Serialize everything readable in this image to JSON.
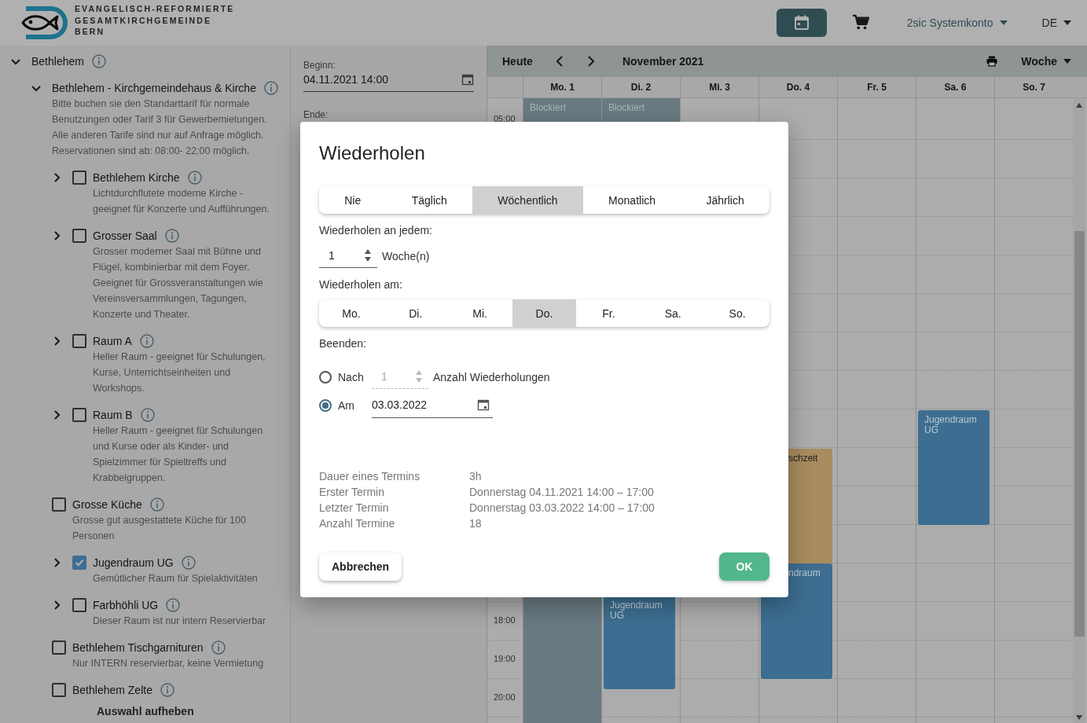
{
  "header": {
    "logo_lines": [
      "EVANGELISCH-REFORMIERTE",
      "GESAMTKIRCHGEMEINDE",
      "BERN"
    ],
    "account": "2sic Systemkonto",
    "language": "DE"
  },
  "sidebar": {
    "items": [
      {
        "label": "Bethlehem",
        "expanded": true,
        "children": [
          {
            "label": "Bethlehem - Kirchgemeindehaus & Kirche",
            "expanded": true,
            "description": "Bitte buchen sie den Standarttarif für normale Benutzungen oder Tarif 3 für Gewerbemietungen. Alle anderen Tarife sind nur auf Anfrage möglich. Reservationen sind ab: 08:00- 22:00 möglich.",
            "children": [
              {
                "label": "Bethlehem Kirche",
                "expanded": false,
                "checked": false,
                "description": "Lichtdurchflutete moderne Kirche - geeignet für Konzerte und Aufführungen."
              },
              {
                "label": "Grosser Saal",
                "expanded": false,
                "checked": false,
                "description": "Grosser moderner Saal mit Bühne und Flügel, kombinierbar mit dem Foyer. Geeignet für Grossveranstaltungen wie Vereinsversammlungen, Tagungen, Konzerte und Theater."
              },
              {
                "label": "Raum A",
                "expanded": false,
                "checked": false,
                "description": "Heller Raum - geeignet für Schulungen, Kurse, Unterrichtseinheiten und Workshops."
              },
              {
                "label": "Raum B",
                "expanded": false,
                "checked": false,
                "description": "Heller Raum - geeignet für Schulungen und Kurse oder als Kinder- und Spielzimmer für Spieltreffs und Krabbelgruppen."
              },
              {
                "label": "Grosse Küche",
                "checked": false,
                "description": "Grosse gut ausgestattete Küche für 100 Personen"
              },
              {
                "label": "Jugendraum UG",
                "expanded": false,
                "checked": true,
                "description": "Gemütlicher Raum für Spielaktivitäten"
              },
              {
                "label": "Farbhöhli UG",
                "expanded": false,
                "checked": false,
                "description": "Dieser Raum ist nur intern Reservierbar"
              },
              {
                "label": "Bethlehem Tischgarnituren",
                "checked": false,
                "description": "Nur INTERN reservierbar, keine Vermietung"
              },
              {
                "label": "Bethlehem Zelte",
                "checked": false
              }
            ]
          }
        ]
      }
    ],
    "clear_button": "Auswahl aufheben"
  },
  "booking_form": {
    "fields": [
      {
        "label": "Beginn:",
        "value": "04.11.2021 14:00"
      },
      {
        "label": "Ende:"
      }
    ]
  },
  "calendar": {
    "today_button": "Heute",
    "period": "November 2021",
    "view": "Woche",
    "days": [
      "Mo. 1",
      "Di. 2",
      "Mi. 3",
      "Do. 4",
      "Fr. 5",
      "Sa. 6",
      "So. 7"
    ],
    "times": [
      "05:00",
      "18:00",
      "19:00",
      "20:00"
    ],
    "events": [
      {
        "title": "Blockiert",
        "kind": "blocked",
        "color": "#697a80"
      },
      {
        "title": "Blockiert",
        "kind": "blocked",
        "color": "#697a80"
      },
      {
        "title": "Jugendraum UG",
        "kind": "booking",
        "color": "#3d6e91"
      },
      {
        "title": "schzeit",
        "kind": "pending",
        "color": "#a88c5f"
      },
      {
        "title": "ndraum",
        "kind": "booking",
        "color": "#3d6e91"
      },
      {
        "title": "Jugendraum UG",
        "kind": "booking",
        "color": "#3d6e91"
      }
    ]
  },
  "dialog": {
    "title": "Wiederholen",
    "frequencies": [
      {
        "label": "Nie",
        "selected": false
      },
      {
        "label": "Täglich",
        "selected": false
      },
      {
        "label": "Wöchentlich",
        "selected": true
      },
      {
        "label": "Monatlich",
        "selected": false
      },
      {
        "label": "Jährlich",
        "selected": false
      }
    ],
    "interval_label": "Wiederholen an jedem:",
    "interval": {
      "value": "1",
      "unit": "Woche(n)"
    },
    "weekdays_label": "Wiederholen am:",
    "weekdays": [
      {
        "label": "Mo.",
        "selected": false
      },
      {
        "label": "Di.",
        "selected": false
      },
      {
        "label": "Mi.",
        "selected": false
      },
      {
        "label": "Do.",
        "selected": true
      },
      {
        "label": "Fr.",
        "selected": false
      },
      {
        "label": "Sa.",
        "selected": false
      },
      {
        "label": "So.",
        "selected": false
      }
    ],
    "end_label": "Beenden:",
    "end_options": [
      {
        "kind": "count",
        "label": "Nach",
        "selected": false,
        "value": "1",
        "unit": "Anzahl Wiederholungen",
        "disabled": true
      },
      {
        "kind": "date",
        "label": "Am",
        "selected": true,
        "value": "03.03.2022"
      }
    ],
    "summary": [
      {
        "label": "Dauer eines Termins",
        "value": "3h"
      },
      {
        "label": "Erster Termin",
        "value": "Donnerstag 04.11.2021 14:00 – 17:00"
      },
      {
        "label": "Letzter Termin",
        "value": "Donnerstag 03.03.2022 14:00 – 17:00"
      },
      {
        "label": "Anzahl Termine",
        "value": "18"
      }
    ],
    "cancel_button": "Abbrechen",
    "ok_button": "OK"
  }
}
